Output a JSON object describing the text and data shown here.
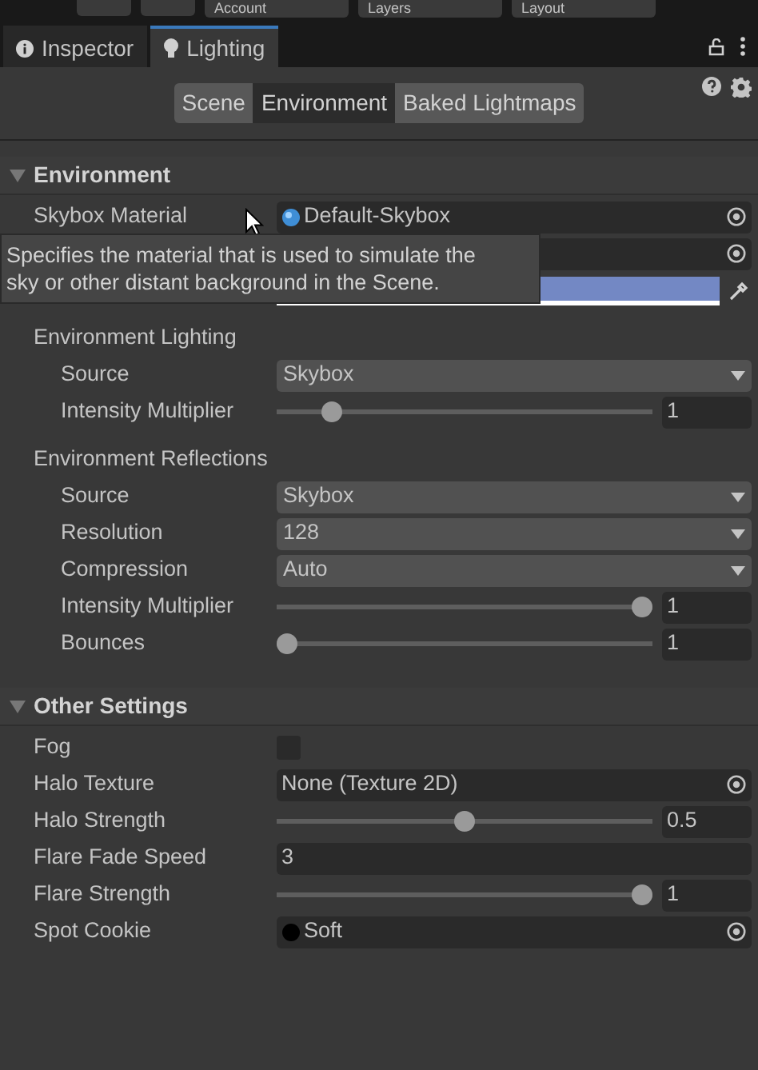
{
  "toolbar": [
    {
      "kind": "icon-button"
    },
    {
      "kind": "icon-button"
    },
    {
      "kind": "dropdown",
      "label": "Account"
    },
    {
      "kind": "dropdown",
      "label": "Layers"
    },
    {
      "kind": "dropdown",
      "label": "Layout"
    }
  ],
  "tabs": [
    {
      "label": "Inspector",
      "selected": false
    },
    {
      "label": "Lighting",
      "selected": true
    }
  ],
  "subtabs": [
    {
      "label": "Scene",
      "selected": false
    },
    {
      "label": "Environment",
      "selected": true
    },
    {
      "label": "Baked Lightmaps",
      "selected": false
    }
  ],
  "sections": [
    {
      "title": "Environment",
      "expanded": true,
      "rows": [
        {
          "kind": "material",
          "label": "Skybox Material",
          "value": "Default-Skybox"
        },
        {
          "kind": "object"
        },
        {
          "kind": "color",
          "color": "#7388c4"
        },
        {
          "kind": "group",
          "label": "Environment Lighting",
          "children": [
            {
              "kind": "dropdown",
              "label": "Source",
              "value": "Skybox"
            },
            {
              "kind": "slider",
              "label": "Intensity Multiplier",
              "level": 0.125,
              "reading": "1"
            }
          ]
        },
        {
          "kind": "group",
          "label": "Environment Reflections",
          "children": [
            {
              "kind": "dropdown",
              "label": "Source",
              "value": "Skybox"
            },
            {
              "kind": "dropdown",
              "label": "Resolution",
              "value": "128"
            },
            {
              "kind": "dropdown",
              "label": "Compression",
              "value": "Auto"
            },
            {
              "kind": "slider",
              "label": "Intensity Multiplier",
              "level": 1,
              "reading": "1"
            },
            {
              "kind": "slider",
              "label": "Bounces",
              "level": 0,
              "reading": "1"
            }
          ]
        }
      ]
    },
    {
      "title": "Other Settings",
      "expanded": true,
      "rows": [
        {
          "kind": "checkbox",
          "label": "Fog",
          "checked": false
        },
        {
          "kind": "object",
          "label": "Halo Texture",
          "value": "None (Texture 2D)"
        },
        {
          "kind": "slider",
          "label": "Halo Strength",
          "level": 0.5,
          "reading": "0.5"
        },
        {
          "kind": "number",
          "label": "Flare Fade Speed",
          "value": "3"
        },
        {
          "kind": "slider",
          "label": "Flare Strength",
          "level": 1,
          "reading": "1"
        },
        {
          "kind": "cookie",
          "label": "Spot Cookie",
          "value": "Soft"
        }
      ]
    }
  ],
  "tooltip": "Specifies the material that is used to simulate the sky or other distant background in the Scene."
}
